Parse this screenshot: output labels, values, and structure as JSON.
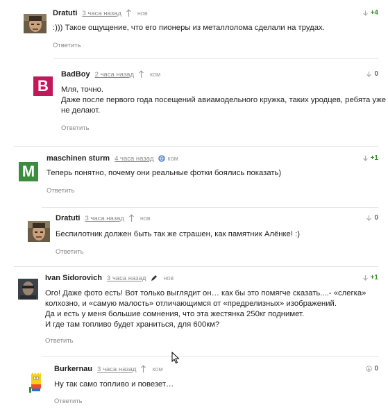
{
  "reply_label": "Ответить",
  "comments": [
    {
      "author": "Dratuti",
      "time": "3 часа назад",
      "badge": "нов",
      "score": "+4",
      "avatar": {
        "kind": "photo",
        "icon": "dratuti-avatar"
      },
      "lines": [
        ":))) Такое ощущение, что его пионеры из металлолома сделали на трудах."
      ]
    },
    {
      "author": "BadBoy",
      "time": "2 часа назад",
      "badge": "ком",
      "score": "0",
      "avatar": {
        "kind": "letter",
        "letter": "B",
        "color": "#c2185b"
      },
      "lines": [
        "Мля, точно.",
        "Даже после первого года посещений авиамодельного кружка, таких уродцев, ребята уже",
        "не делают."
      ]
    },
    {
      "author": "maschinen sturm",
      "time": "4 часа назад",
      "badge": "ком",
      "score": "+1",
      "avatar": {
        "kind": "letter",
        "letter": "M",
        "color": "#388e3c"
      },
      "lines": [
        "Теперь понятно, почему они реальные фотки боялись показать)"
      ]
    },
    {
      "author": "Dratuti",
      "time": "3 часа назад",
      "badge": "нов",
      "score": "0",
      "avatar": {
        "kind": "photo",
        "icon": "dratuti-avatar"
      },
      "lines": [
        "Беспилотник должен быть так же страшен, как памятник Алёнке! :)"
      ]
    },
    {
      "author": "Ivan Sidorovich",
      "time": "3 часа назад",
      "badge": "нов",
      "score": "+1",
      "avatar": {
        "kind": "photo",
        "icon": "ivan-avatar"
      },
      "lines": [
        "Ого! Даже фото есть! Вот только выглядит он… как бы это помягче сказать....- «слегка»",
        "колхозно, и «самую малость» отличающимся от «предрелизных» изображений.",
        "Да и есть у меня большие сомнения, что эта жестянка 250кг поднимет.",
        "И где там топливо будет храниться, для 600км?"
      ]
    },
    {
      "author": "Burkernau",
      "time": "3 часа назад",
      "badge": "ком",
      "score": "0",
      "avatar": {
        "kind": "photo",
        "icon": "bart-avatar"
      },
      "lines": [
        "Ну так само топливо и повезет…"
      ]
    }
  ],
  "colors": {
    "positive": "#3a8d2a",
    "neutral": "#666666",
    "text": "#222222",
    "meta": "#888888"
  }
}
